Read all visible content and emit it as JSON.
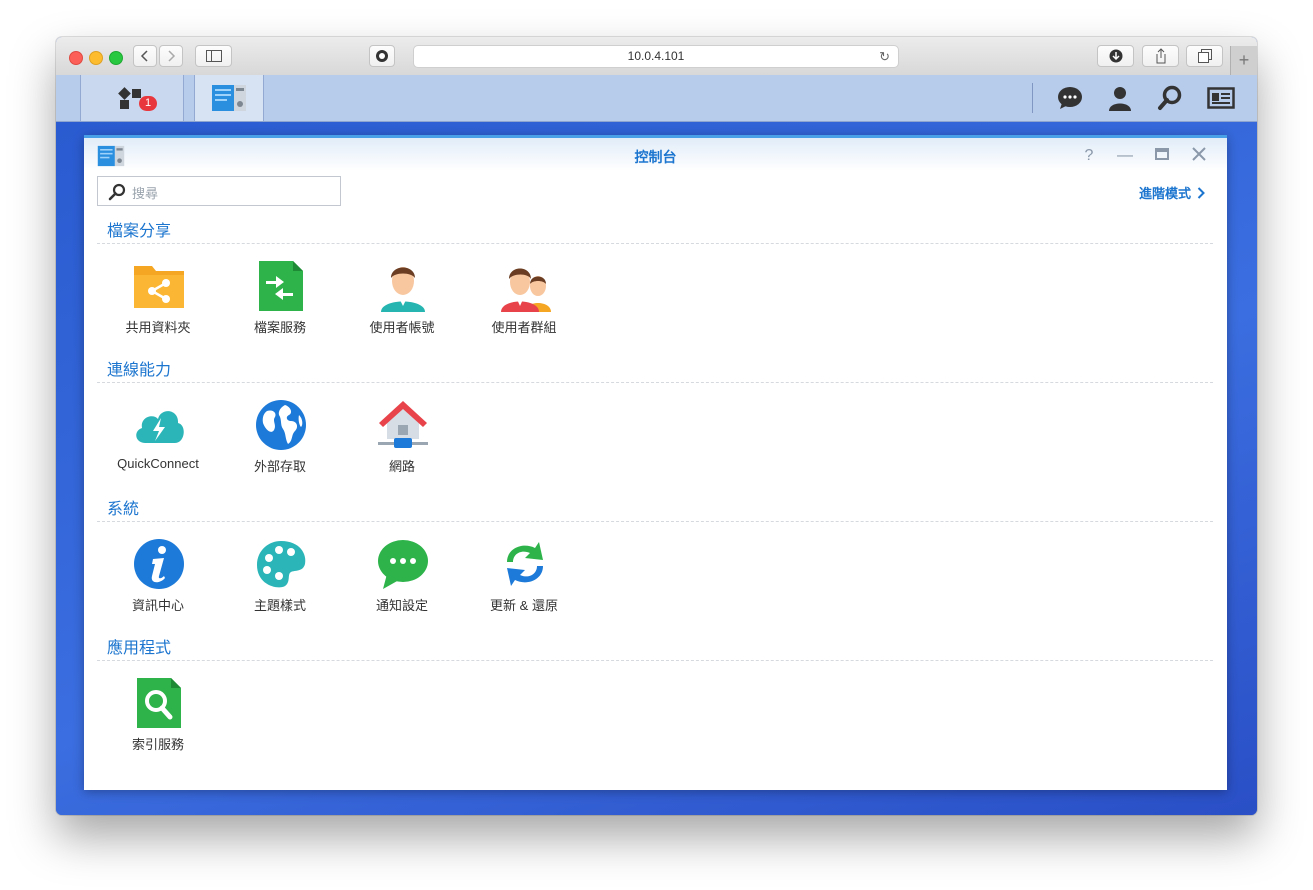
{
  "browser": {
    "url": "10.0.4.101",
    "newtab_label": "+"
  },
  "taskbar": {
    "main_menu_badge": "1"
  },
  "window": {
    "title": "控制台",
    "search_placeholder": "搜尋",
    "advanced_mode": "進階模式"
  },
  "sections": [
    {
      "title": "檔案分享",
      "items": [
        {
          "label": "共用資料夾",
          "icon": "shared-folder-icon"
        },
        {
          "label": "檔案服務",
          "icon": "file-services-icon"
        },
        {
          "label": "使用者帳號",
          "icon": "user-icon"
        },
        {
          "label": "使用者群組",
          "icon": "group-icon"
        }
      ]
    },
    {
      "title": "連線能力",
      "items": [
        {
          "label": "QuickConnect",
          "icon": "quickconnect-icon"
        },
        {
          "label": "外部存取",
          "icon": "globe-icon"
        },
        {
          "label": "網路",
          "icon": "network-house-icon"
        }
      ]
    },
    {
      "title": "系統",
      "items": [
        {
          "label": "資訊中心",
          "icon": "info-icon"
        },
        {
          "label": "主題樣式",
          "icon": "palette-icon"
        },
        {
          "label": "通知設定",
          "icon": "chat-bubble-icon"
        },
        {
          "label": "更新 & 還原",
          "icon": "refresh-icon"
        }
      ]
    },
    {
      "title": "應用程式",
      "items": [
        {
          "label": "索引服務",
          "icon": "indexing-icon"
        }
      ]
    }
  ],
  "colors": {
    "accent": "#1c75cf",
    "desktop": "#2d5fd3",
    "badge": "#e8383d"
  }
}
